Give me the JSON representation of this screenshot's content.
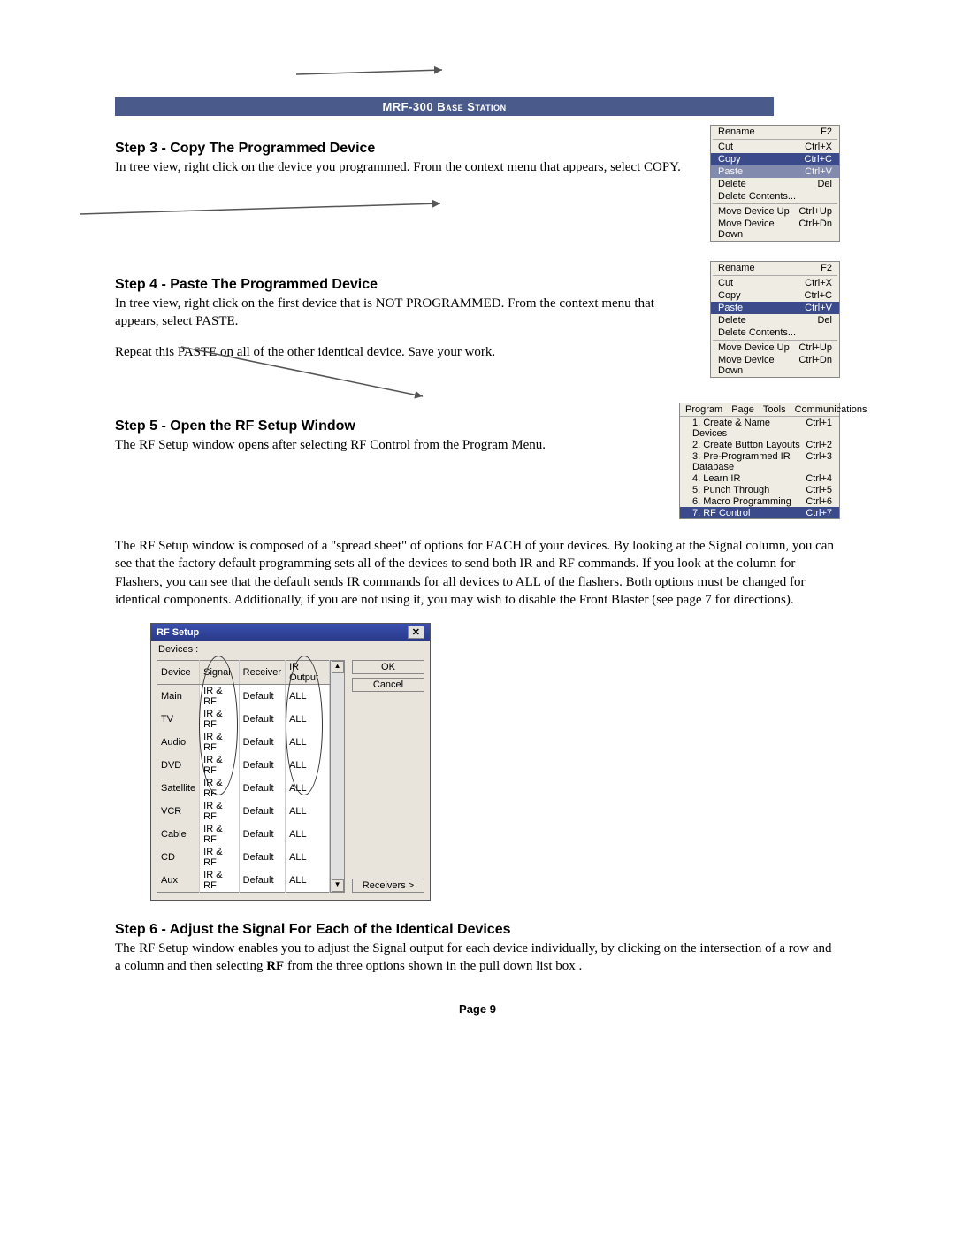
{
  "header_bar": "MRF-300 Base Station",
  "step3": {
    "title": "Step 3 - Copy The Programmed Device",
    "body": "In tree view, right click on the device you programmed. From the context menu that appears, select COPY."
  },
  "step4": {
    "title": "Step 4 - Paste The Programmed Device",
    "body1": "In tree view, right click on the first device that is NOT PROGRAMMED. From the context menu that appears, select PASTE.",
    "body2": "Repeat this PASTE on all of the other identical device. Save your work."
  },
  "step5": {
    "title": "Step 5 - Open the RF Setup Window",
    "body1": "The RF Setup window opens after selecting RF Control from the Program Menu.",
    "body2": "The RF Setup window is composed of a \"spread sheet\" of options for EACH of your devices.  By looking at the Signal column, you can see that the factory default programming sets all of the devices to send both IR and RF commands. If you look at the column for Flashers, you can see that the default sends IR commands for all devices to ALL of the flashers. Both options must be changed for identical components. Additionally, if you are not using it, you may wish to disable the Front Blaster (see page 7 for directions)."
  },
  "step6": {
    "title": "Step 6 - Adjust the Signal For Each of the Identical Devices",
    "body": "The RF Setup window enables you to adjust the Signal output for each device individually, by clicking on the intersection of a row and a column and then selecting RF from the three options shown in the pull down list box .",
    "bold_word": "RF"
  },
  "context_menu": {
    "rename": "Rename",
    "rename_k": "F2",
    "cut": "Cut",
    "cut_k": "Ctrl+X",
    "copy": "Copy",
    "copy_k": "Ctrl+C",
    "paste": "Paste",
    "paste_k": "Ctrl+V",
    "delete": "Delete",
    "delete_k": "Del",
    "delete_contents": "Delete Contents...",
    "move_up": "Move Device Up",
    "move_up_k": "Ctrl+Up",
    "move_down": "Move Device Down",
    "move_down_k": "Ctrl+Dn"
  },
  "program_menu": {
    "bar": [
      "Program",
      "Page",
      "Tools",
      "Communications"
    ],
    "items": [
      {
        "label": "1. Create & Name Devices",
        "k": "Ctrl+1"
      },
      {
        "label": "2. Create Button Layouts",
        "k": "Ctrl+2"
      },
      {
        "label": "3. Pre-Programmed IR Database",
        "k": "Ctrl+3"
      },
      {
        "label": "4. Learn IR",
        "k": "Ctrl+4"
      },
      {
        "label": "5. Punch Through",
        "k": "Ctrl+5"
      },
      {
        "label": "6. Macro Programming",
        "k": "Ctrl+6"
      },
      {
        "label": "7. RF Control",
        "k": "Ctrl+7"
      }
    ],
    "highlight_index": 6
  },
  "rf_setup": {
    "title": "RF Setup",
    "label": "Devices :",
    "headers": [
      "Device",
      "Signal",
      "Receiver",
      "IR Output"
    ],
    "rows": [
      [
        "Main",
        "IR & RF",
        "Default",
        "ALL"
      ],
      [
        "TV",
        "IR & RF",
        "Default",
        "ALL"
      ],
      [
        "Audio",
        "IR & RF",
        "Default",
        "ALL"
      ],
      [
        "DVD",
        "IR & RF",
        "Default",
        "ALL"
      ],
      [
        "Satellite",
        "IR & RF",
        "Default",
        "ALL"
      ],
      [
        "VCR",
        "IR & RF",
        "Default",
        "ALL"
      ],
      [
        "Cable",
        "IR & RF",
        "Default",
        "ALL"
      ],
      [
        "CD",
        "IR & RF",
        "Default",
        "ALL"
      ],
      [
        "Aux",
        "IR & RF",
        "Default",
        "ALL"
      ]
    ],
    "ok": "OK",
    "cancel": "Cancel",
    "receivers": "Receivers >"
  },
  "page_number": "Page 9"
}
